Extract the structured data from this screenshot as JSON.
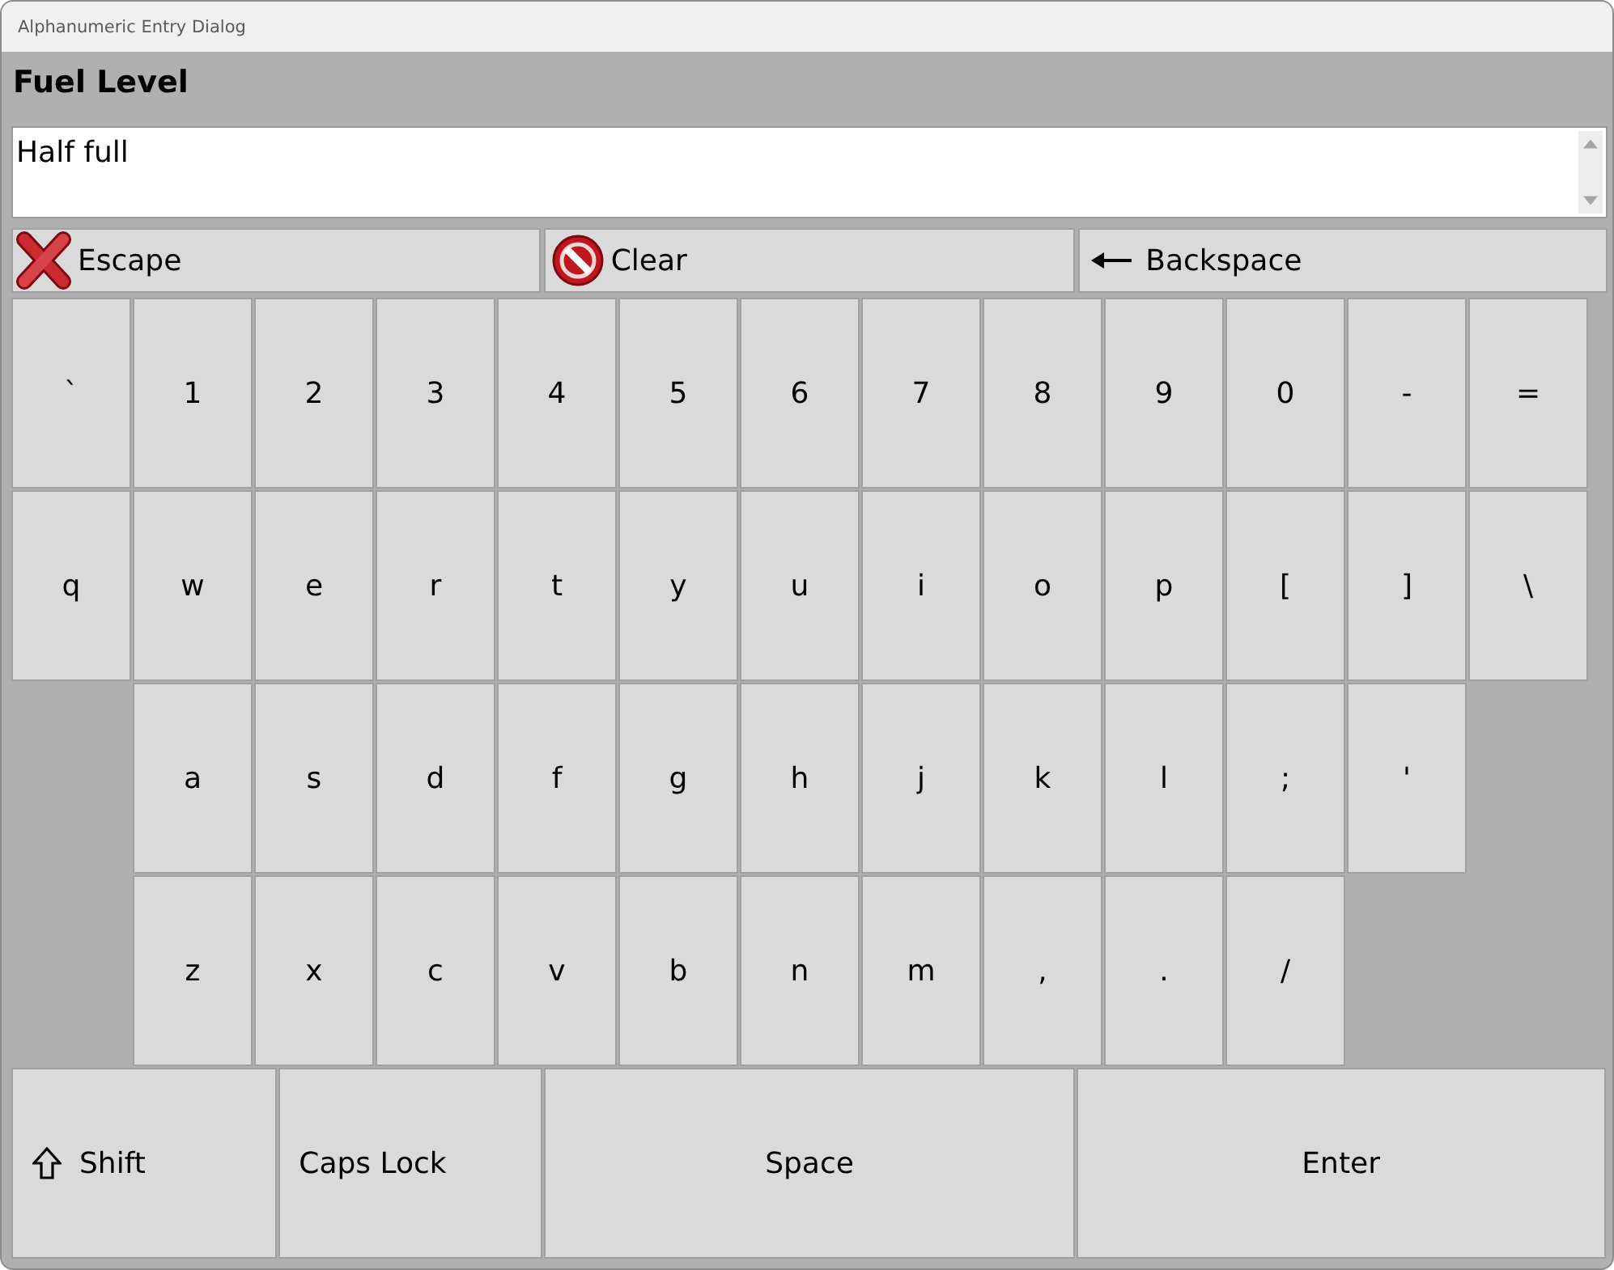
{
  "window": {
    "title": "Alphanumeric Entry Dialog"
  },
  "prompt": "Fuel Level",
  "entry": {
    "value": "Half full"
  },
  "action_buttons": [
    {
      "label": "Escape",
      "kind": "escape"
    },
    {
      "label": "Clear",
      "kind": "clear"
    },
    {
      "label": "Backspace",
      "kind": "backspace"
    }
  ],
  "key_rows": [
    {
      "kind": "full",
      "keys": [
        "`",
        "1",
        "2",
        "3",
        "4",
        "5",
        "6",
        "7",
        "8",
        "9",
        "0",
        "-",
        "="
      ]
    },
    {
      "kind": "full",
      "keys": [
        "q",
        "w",
        "e",
        "r",
        "t",
        "y",
        "u",
        "i",
        "o",
        "p",
        "[",
        "]",
        "\\"
      ]
    },
    {
      "kind": "indented",
      "keys": [
        "a",
        "s",
        "d",
        "f",
        "g",
        "h",
        "j",
        "k",
        "l",
        ";",
        "'"
      ]
    },
    {
      "kind": "indented",
      "keys": [
        "z",
        "x",
        "c",
        "v",
        "b",
        "n",
        "m",
        ",",
        ".",
        "/"
      ]
    }
  ],
  "bottom_keys": [
    {
      "label": "Shift",
      "kind": "shift"
    },
    {
      "label": "Caps Lock",
      "kind": "caps"
    },
    {
      "label": "Space",
      "kind": "space"
    },
    {
      "label": "Enter",
      "kind": "enter"
    }
  ]
}
